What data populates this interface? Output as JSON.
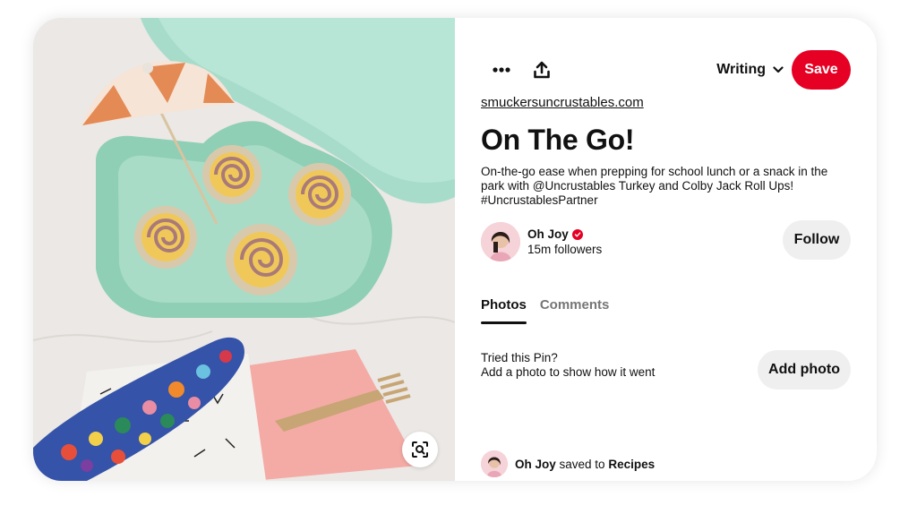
{
  "image": {
    "description_icon": "visual-search-icon"
  },
  "toolbar": {
    "more_icon": "ellipsis-icon",
    "share_icon": "share-upload-icon",
    "board_label": "Writing",
    "board_chevron_icon": "chevron-down-icon",
    "save_label": "Save",
    "save_color": "#e60023"
  },
  "pin": {
    "source": "smuckersuncrustables.com",
    "title": "On The Go!",
    "description": "On-the-go ease when prepping for school lunch or a snack in the park with @Uncrustables Turkey and Colby Jack Roll Ups! #UncrustablesPartner"
  },
  "creator": {
    "name": "Oh Joy",
    "verified_icon": "verified-badge-icon",
    "followers": "15m followers",
    "follow_label": "Follow"
  },
  "tabs": [
    {
      "label": "Photos",
      "active": true
    },
    {
      "label": "Comments",
      "active": false
    }
  ],
  "tried": {
    "title": "Tried this Pin?",
    "subtitle": "Add a photo to show how it went",
    "button_label": "Add photo"
  },
  "saved": {
    "user": "Oh Joy",
    "middle": "saved to",
    "board": "Recipes"
  }
}
